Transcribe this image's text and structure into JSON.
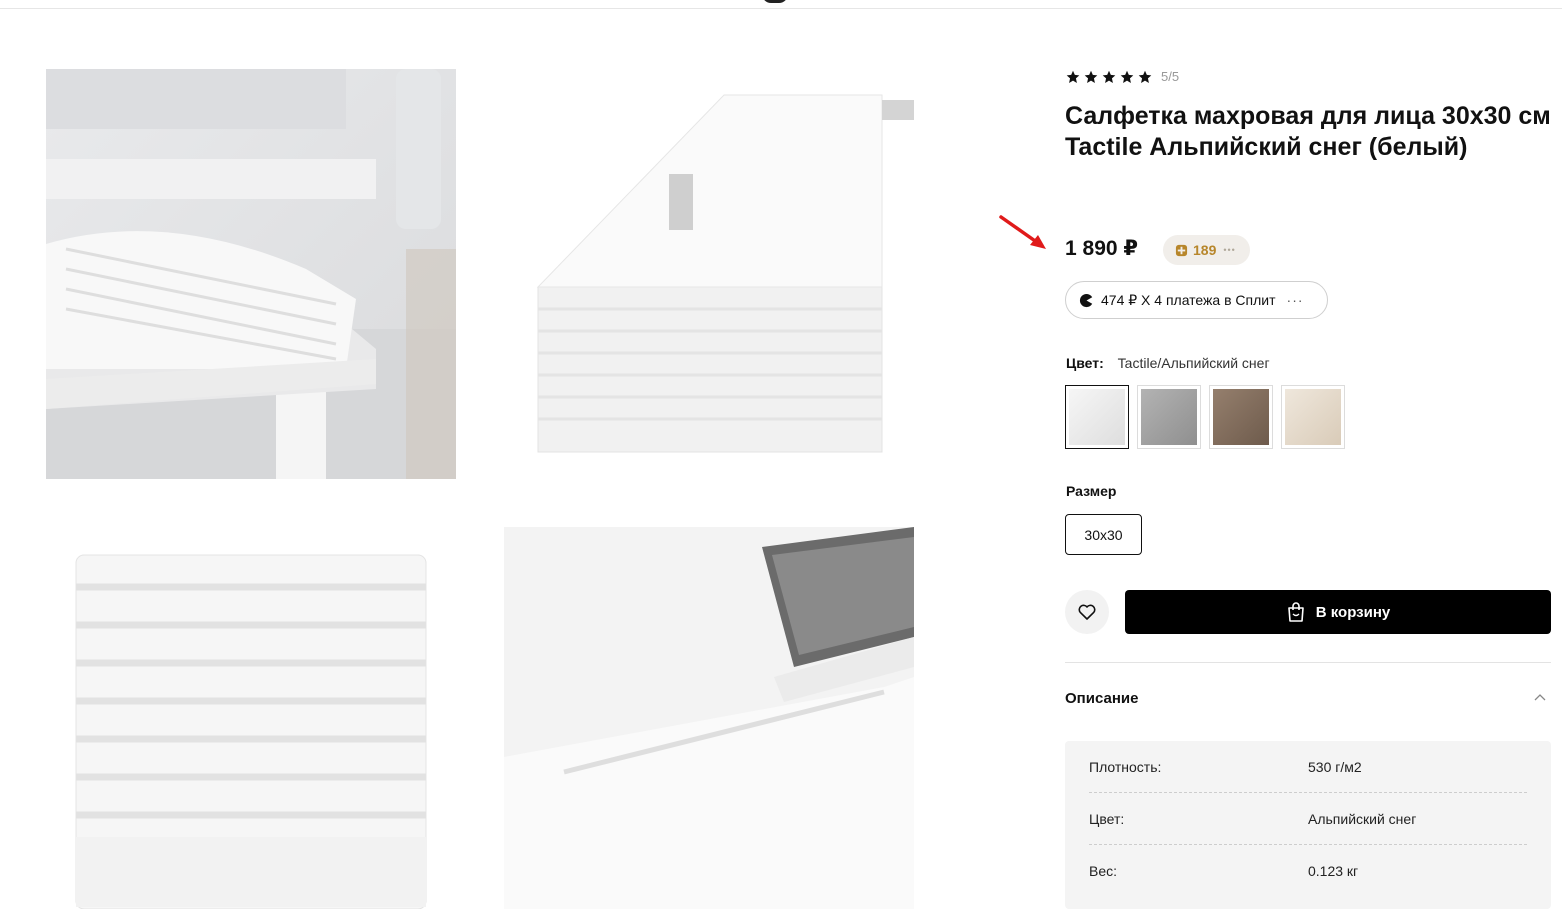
{
  "rating": {
    "stars": 5,
    "score_text": "5/5"
  },
  "product": {
    "title": "Салфетка махровая для лица 30х30 см Tactile Альпийский снег (белый)",
    "price": "1 890 ₽",
    "bonus_points": "189",
    "split_offer": "474 ₽ Х 4 платежа в Сплит"
  },
  "color": {
    "label": "Цвет:",
    "value": "Tactile/Альпийский снег",
    "swatches": [
      {
        "name": "Альпийский снег",
        "color": "#eeeeee",
        "selected": true
      },
      {
        "name": "grey",
        "color": "#a3a3a3",
        "selected": false
      },
      {
        "name": "brown",
        "color": "#857262",
        "selected": false
      },
      {
        "name": "beige",
        "color": "#e6ddd0",
        "selected": false
      }
    ]
  },
  "size": {
    "label": "Размер",
    "options": [
      "30x30"
    ],
    "selected": "30x30"
  },
  "actions": {
    "cart_label": "В корзину"
  },
  "description": {
    "heading": "Описание",
    "specs": [
      {
        "key": "Плотность:",
        "value": "530 г/м2"
      },
      {
        "key": "Цвет:",
        "value": "Альпийский снег"
      },
      {
        "key": "Вес:",
        "value": "0.123 кг"
      }
    ]
  },
  "colors": {
    "accent_gold": "#b7862b",
    "arrow_red": "#e01a1a",
    "button_black": "#000000"
  }
}
